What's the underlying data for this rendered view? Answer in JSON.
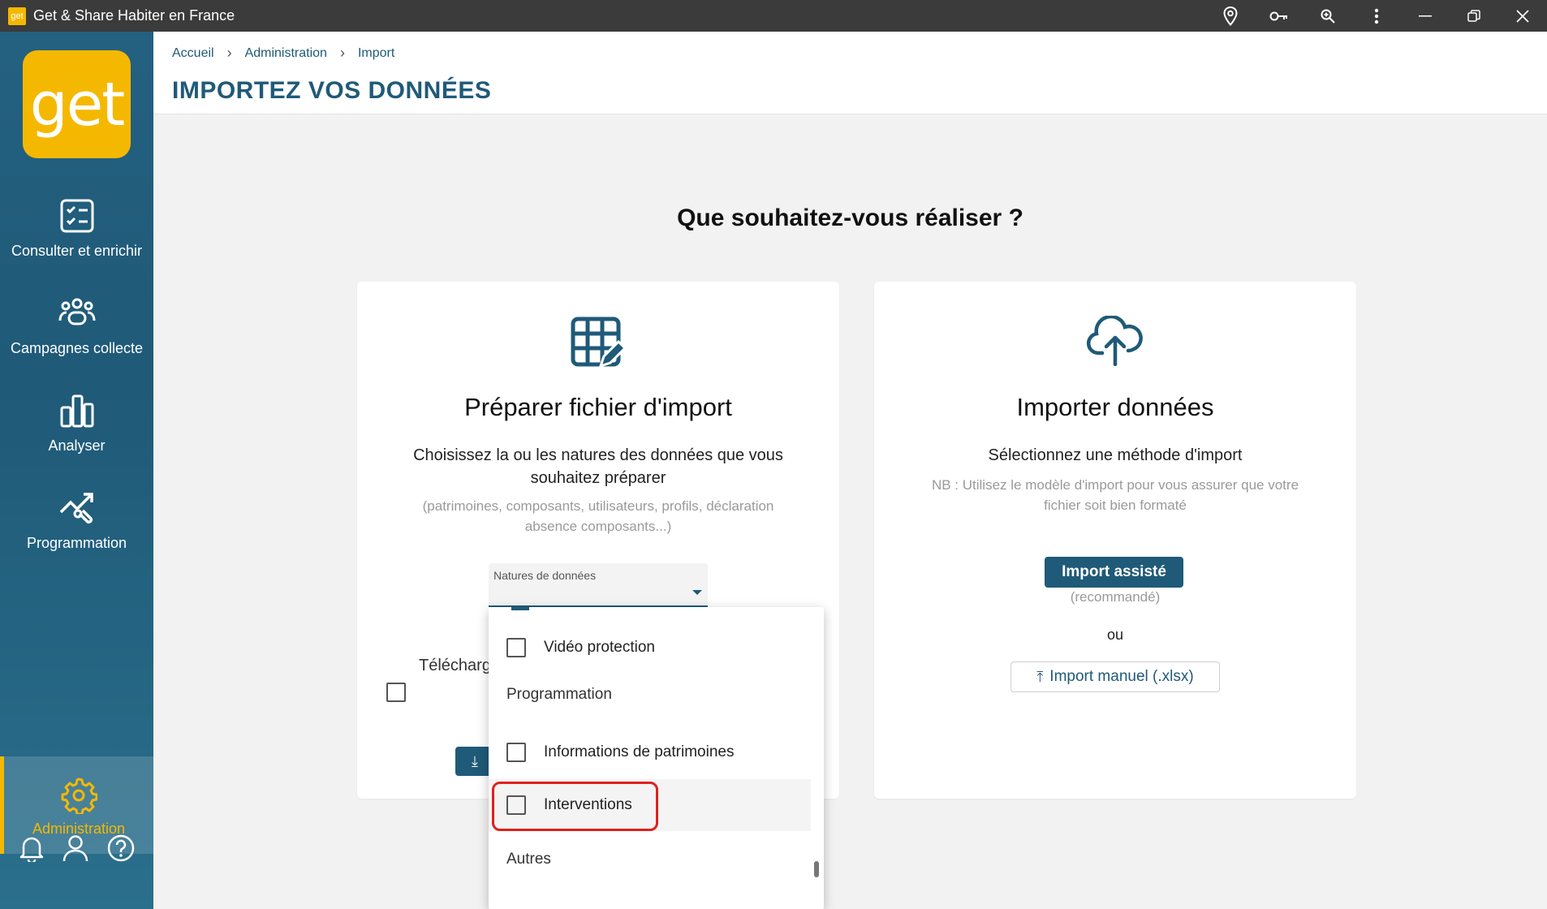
{
  "window": {
    "title": "Get & Share Habiter en France",
    "app_icon_text": "get"
  },
  "sidebar": {
    "logo_text": "get",
    "items": [
      {
        "label": "Consulter et enrichir",
        "icon": "checklist-icon"
      },
      {
        "label": "Campagnes collecte",
        "icon": "users-group-icon"
      },
      {
        "label": "Analyser",
        "icon": "bar-chart-icon"
      },
      {
        "label": "Programmation",
        "icon": "tools-icon"
      }
    ],
    "admin": {
      "label": "Administration",
      "icon": "gear-icon"
    },
    "accent": "#f5b800"
  },
  "breadcrumb": [
    "Accueil",
    "Administration",
    "Import"
  ],
  "page_title": "IMPORTEZ VOS DONNÉES",
  "question": "Que souhaitez-vous réaliser ?",
  "card_prepare": {
    "title": "Préparer fichier d'import",
    "description": "Choisissez la ou les natures des données que vous souhaitez préparer",
    "note": "(patrimoines, composants, utilisateurs, profils, déclaration absence composants...)",
    "select_label": "Natures de données",
    "download_text": "Télécharger données secondes"
  },
  "card_import": {
    "title": "Importer données",
    "description": "Sélectionnez une méthode d'import",
    "note": "NB : Utilisez le modèle d'import pour vous assurer que votre fichier soit bien formaté",
    "primary_button": "Import assisté",
    "recommended": "(recommandé)",
    "or": "ou",
    "manual_button": "Import manuel (.xlsx)"
  },
  "dropdown": {
    "items": [
      {
        "type": "option",
        "label": "Vidéo protection"
      },
      {
        "type": "group",
        "label": "Programmation"
      },
      {
        "type": "option",
        "label": "Informations de patrimoines"
      },
      {
        "type": "option",
        "label": "Interventions"
      },
      {
        "type": "group",
        "label": "Autres"
      }
    ]
  },
  "colors": {
    "primary": "#1f5a78",
    "accent": "#f5b800",
    "highlight": "#e0201d"
  }
}
